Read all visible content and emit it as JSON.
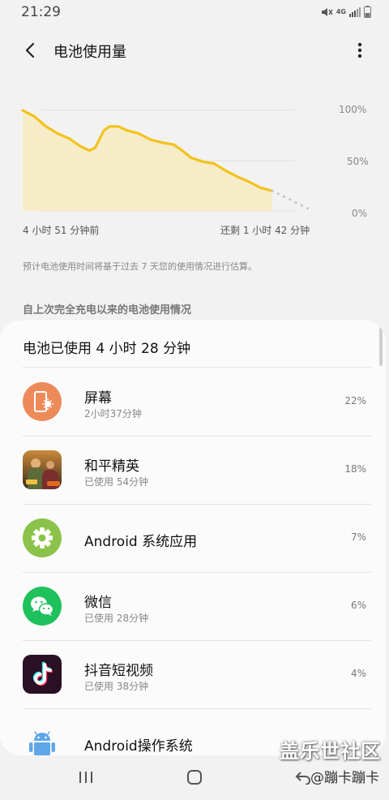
{
  "status_bar": {
    "time": "21:29",
    "network_label": "4G",
    "icons": [
      "mute-icon",
      "network-4g-icon",
      "signal-icon",
      "battery-icon"
    ]
  },
  "app_bar": {
    "title": "电池使用量",
    "back_icon": "chevron-left-icon",
    "more_icon": "more-vertical-icon"
  },
  "chart_data": {
    "type": "area",
    "y_ticks": [
      "100%",
      "50%",
      "0%"
    ],
    "ylim": [
      0,
      100
    ],
    "x_start_label": "4 小时 51 分钟前",
    "x_end_label": "还剩 1 小时 42 分钟",
    "series": [
      {
        "role": "actual",
        "color": "#f2c21b",
        "points": [
          [
            0,
            100
          ],
          [
            4,
            94
          ],
          [
            8,
            84
          ],
          [
            12,
            77
          ],
          [
            16,
            72
          ],
          [
            20,
            64
          ],
          [
            23,
            60
          ],
          [
            25,
            63
          ],
          [
            28,
            80
          ],
          [
            30,
            84
          ],
          [
            33,
            84
          ],
          [
            36,
            80
          ],
          [
            40,
            77
          ],
          [
            44,
            71
          ],
          [
            48,
            68
          ],
          [
            52,
            66
          ],
          [
            55,
            60
          ],
          [
            58,
            53
          ],
          [
            62,
            49
          ],
          [
            66,
            47
          ],
          [
            70,
            40
          ],
          [
            74,
            34
          ],
          [
            78,
            29
          ],
          [
            82,
            23
          ],
          [
            86,
            20
          ]
        ]
      },
      {
        "role": "projected",
        "color": "#c4c4c4",
        "points": [
          [
            86,
            20
          ],
          [
            100,
            0
          ]
        ]
      }
    ],
    "grid": true,
    "fill_color": "#f7ecc8"
  },
  "estimate_note": "预计电池使用时间将基于过去 7 天您的使用情况进行估算。",
  "section_header": "自上次完全充电以来的电池使用情况",
  "usage": {
    "total": "电池已使用 4 小时 28 分钟",
    "apps": [
      {
        "name": "屏幕",
        "sub": "2小时37分钟",
        "percent": "22%",
        "icon": "screen-brightness-icon"
      },
      {
        "name": "和平精英",
        "sub": "已使用 54分钟",
        "percent": "18%",
        "icon": "game-peace-elite-icon"
      },
      {
        "name": "Android 系统应用",
        "sub": "",
        "percent": "7%",
        "icon": "gear-icon"
      },
      {
        "name": "微信",
        "sub": "已使用 28分钟",
        "percent": "6%",
        "icon": "wechat-icon"
      },
      {
        "name": "抖音短视频",
        "sub": "已使用 38分钟",
        "percent": "4%",
        "icon": "tiktok-icon"
      },
      {
        "name": "Android操作系统",
        "sub": "",
        "percent": "",
        "icon": "android-robot-icon"
      }
    ]
  },
  "nav_bar": {
    "icons": [
      "recents-icon",
      "home-icon",
      "back-nav-icon"
    ]
  },
  "watermark": {
    "title": "盖乐世社区",
    "user": "@蹦卡蹦卡"
  }
}
